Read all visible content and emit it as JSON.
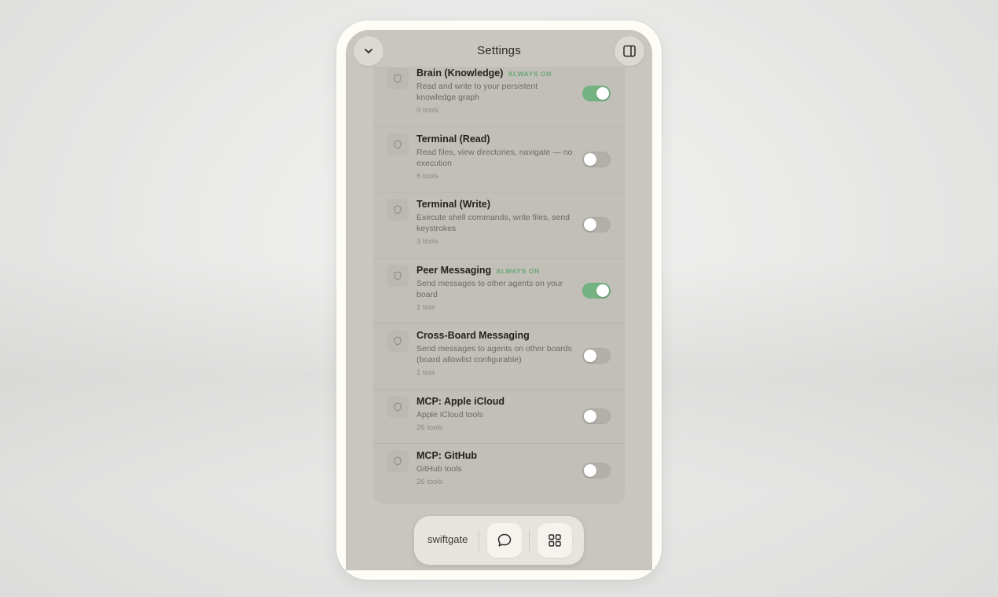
{
  "header": {
    "title": "Settings"
  },
  "tools": [
    {
      "name": "Brain (Knowledge)",
      "badge": "ALWAYS ON",
      "description": "Read and write to your persistent knowledge graph",
      "count": "9 tools",
      "enabled": true
    },
    {
      "name": "Terminal (Read)",
      "badge": "",
      "description": "Read files, view directories, navigate — no execution",
      "count": "6 tools",
      "enabled": false
    },
    {
      "name": "Terminal (Write)",
      "badge": "",
      "description": "Execute shell commands, write files, send keystrokes",
      "count": "3 tools",
      "enabled": false
    },
    {
      "name": "Peer Messaging",
      "badge": "ALWAYS ON",
      "description": "Send messages to other agents on your board",
      "count": "1 tool",
      "enabled": true
    },
    {
      "name": "Cross-Board Messaging",
      "badge": "",
      "description": "Send messages to agents on other boards (board allowlist configurable)",
      "count": "1 tool",
      "enabled": false
    },
    {
      "name": "MCP: Apple iCloud",
      "badge": "",
      "description": "Apple iCloud tools",
      "count": "26 tools",
      "enabled": false
    },
    {
      "name": "MCP: GitHub",
      "badge": "",
      "description": "GitHub tools",
      "count": "26 tools",
      "enabled": false
    }
  ],
  "dock": {
    "brand": "swiftgate"
  },
  "colors": {
    "toggle_on": "#74b482",
    "badge": "#6aa877",
    "screen_bg": "#c9c6bf"
  }
}
